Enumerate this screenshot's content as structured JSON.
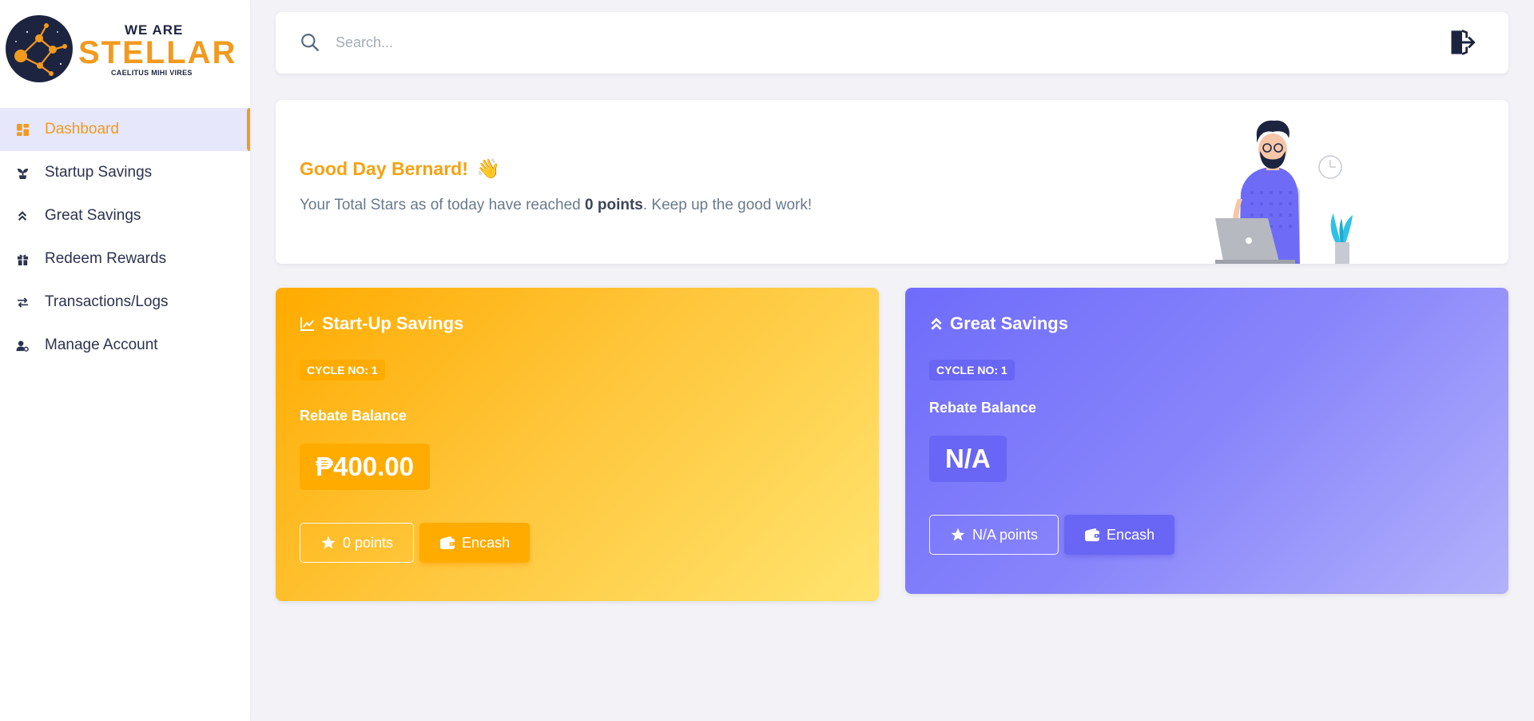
{
  "brand": {
    "top": "WE ARE",
    "main": "STELLAR",
    "tagline": "CAELITUS MIHI VIRES",
    "colors": {
      "orange": "#f29a1f",
      "navy": "#1d2440"
    }
  },
  "sidebar": {
    "items": [
      {
        "label": "Dashboard",
        "icon": "dashboard-icon",
        "active": true
      },
      {
        "label": "Startup Savings",
        "icon": "seedling-icon"
      },
      {
        "label": "Great Savings",
        "icon": "double-chevron-up-icon"
      },
      {
        "label": "Redeem Rewards",
        "icon": "gift-icon"
      },
      {
        "label": "Transactions/Logs",
        "icon": "transfer-arrows-icon"
      },
      {
        "label": "Manage Account",
        "icon": "user-cog-icon"
      }
    ]
  },
  "search": {
    "placeholder": "Search...",
    "value": ""
  },
  "welcome": {
    "greeting": "Good Day Bernard!",
    "wave": "👋",
    "message_prefix": "Your Total Stars as of today have reached",
    "points": "0 points",
    "message_suffix": ". Keep up the good work!"
  },
  "startup_card": {
    "title": "Start-Up Savings",
    "cycle": "CYCLE NO: 1",
    "rebate_label": "Rebate Balance",
    "balance": "₱400.00",
    "points_button": "0 points",
    "encash_button": "Encash",
    "accent": "#ffab00"
  },
  "great_card": {
    "title": "Great Savings",
    "cycle": "CYCLE NO: 1",
    "rebate_label": "Rebate Balance",
    "balance": "N/A",
    "points_button": "N/A points",
    "encash_button": "Encash",
    "accent": "#6966f5"
  }
}
